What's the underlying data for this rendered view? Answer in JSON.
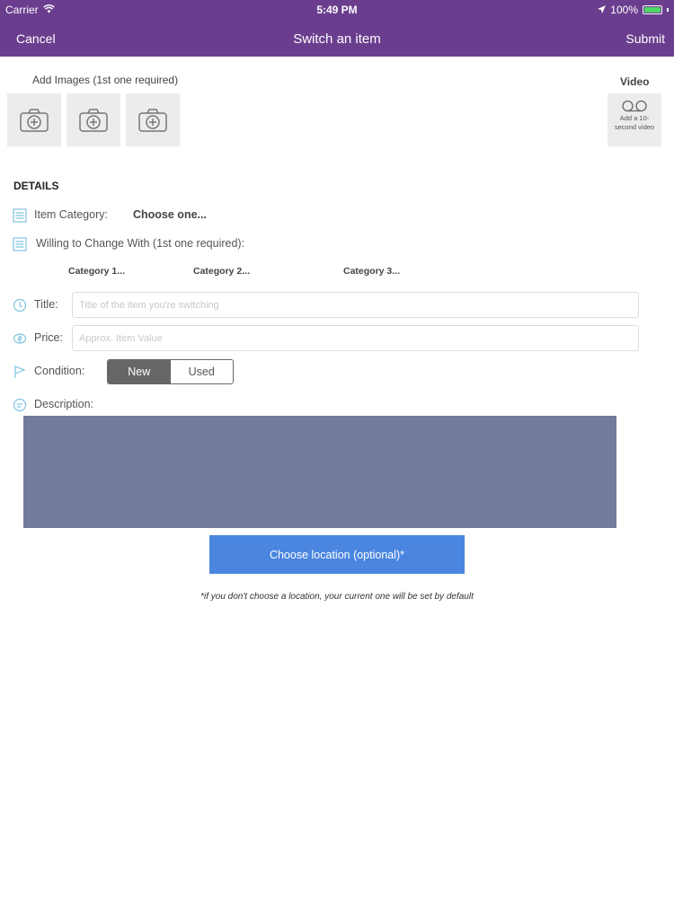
{
  "status_bar": {
    "carrier": "Carrier",
    "time": "5:49 PM",
    "battery": "100%"
  },
  "nav": {
    "cancel": "Cancel",
    "title": "Switch an item",
    "submit": "Submit"
  },
  "images": {
    "label": "Add Images (1st one required)",
    "slot_count": 3
  },
  "video": {
    "label": "Video",
    "button_text": "Add a 10-second video"
  },
  "details": {
    "heading": "DETAILS",
    "item_category_label": "Item Category:",
    "item_category_value": "Choose one...",
    "willing_label": "Willing to Change With (1st one required):",
    "categories": [
      "Category 1...",
      "Category 2...",
      "Category 3..."
    ],
    "title_label": "Title:",
    "title_placeholder": "Title of the item you're switching",
    "price_label": "Price:",
    "price_placeholder": "Approx. Item Value",
    "condition_label": "Condition:",
    "condition_options": [
      "New",
      "Used"
    ],
    "condition_selected": "New",
    "description_label": "Description:"
  },
  "location": {
    "button": "Choose location (optional)*",
    "note": "*if you don't choose a location, your current one will be set by default"
  },
  "colors": {
    "header": "#6a3d8e",
    "accent_button": "#4a86e0",
    "description_box": "#747a9a",
    "icon_tint": "#5bc0de"
  }
}
